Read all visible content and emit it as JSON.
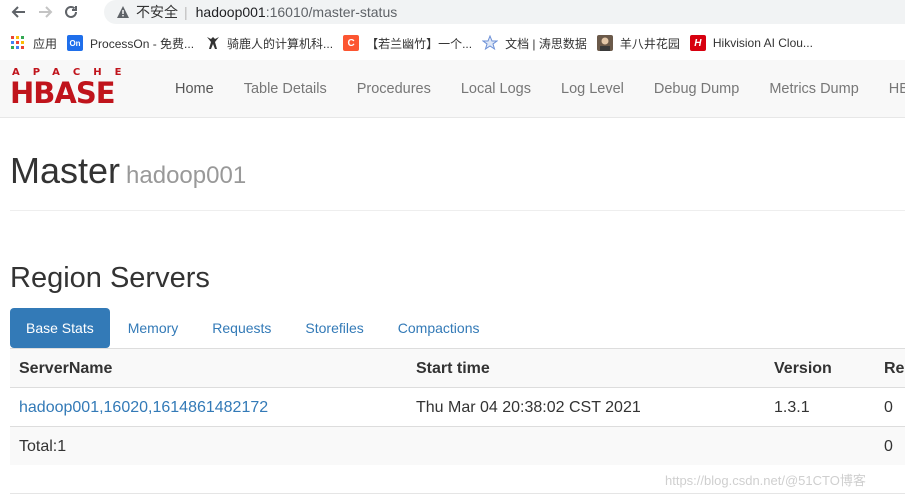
{
  "browser": {
    "insecure_label": "不安全",
    "url_host": "hadoop001",
    "url_rest": ":16010/master-status"
  },
  "bookmarks": [
    {
      "label": "应用",
      "icon": "apps-grid-icon"
    },
    {
      "label": "ProcessOn - 免费...",
      "icon": "processon-icon",
      "badge": "On",
      "color": "#1f6feb"
    },
    {
      "label": "骑鹿人的计算机科...",
      "icon": "figure-icon"
    },
    {
      "label": "【若兰幽竹】一个...",
      "icon": "csdn-icon",
      "badge": "C",
      "color": "#fc5531"
    },
    {
      "label": "文档 | 涛思数据",
      "icon": "star-icon"
    },
    {
      "label": "羊八井花园",
      "icon": "avatar-icon"
    },
    {
      "label": "Hikvision AI Clou...",
      "icon": "hikvision-icon",
      "badge": "H",
      "color": "#d7000f"
    }
  ],
  "logo": {
    "top": "APACHE",
    "main": "HBASE"
  },
  "nav": [
    "Home",
    "Table Details",
    "Procedures",
    "Local Logs",
    "Log Level",
    "Debug Dump",
    "Metrics Dump",
    "HBas"
  ],
  "header": {
    "title": "Master",
    "host": "hadoop001"
  },
  "region_servers": {
    "title": "Region Servers",
    "tabs": [
      "Base Stats",
      "Memory",
      "Requests",
      "Storefiles",
      "Compactions"
    ],
    "columns": [
      "ServerName",
      "Start time",
      "Version",
      "Re"
    ],
    "rows": [
      {
        "server": "hadoop001,16020,1614861482172",
        "start": "Thu Mar 04 20:38:02 CST 2021",
        "version": "1.3.1",
        "requests": "0"
      }
    ],
    "total": {
      "label": "Total:1",
      "requests": "0"
    }
  },
  "watermark": "https://blog.csdn.net/@51CTO博客"
}
